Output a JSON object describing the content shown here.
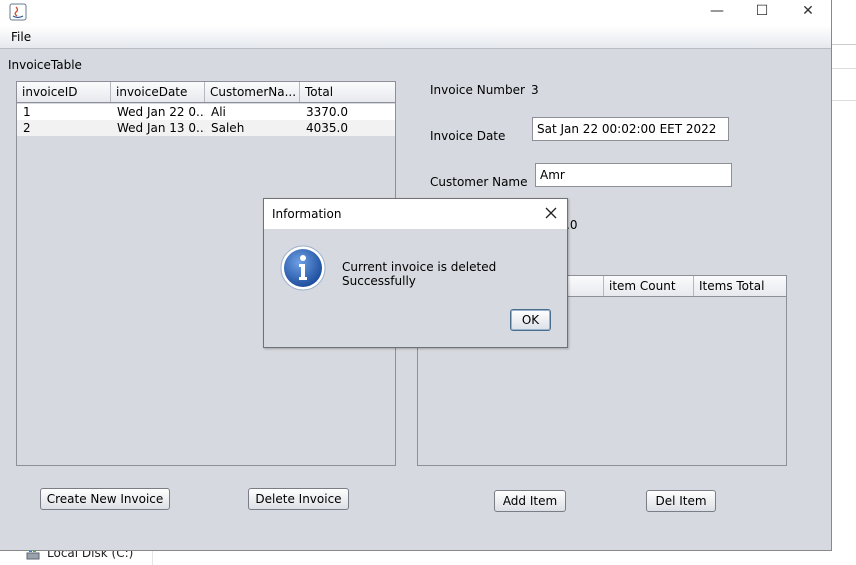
{
  "window": {
    "title": "",
    "minimize_glyph": "—",
    "maximize_glyph": "☐",
    "close_glyph": "✕"
  },
  "menu": {
    "file": "File"
  },
  "invoice_table": {
    "label": "InvoiceTable",
    "columns": [
      "invoiceID",
      "invoiceDate",
      "CustomerNa...",
      "Total"
    ],
    "rows": [
      [
        "1",
        "Wed Jan 22 0...",
        "Ali",
        "3370.0"
      ],
      [
        "2",
        "Wed Jan 13 0...",
        "Saleh",
        "4035.0"
      ]
    ]
  },
  "details": {
    "invoice_number_label": "Invoice Number",
    "invoice_number_value": "3",
    "invoice_date_label": "Invoice Date",
    "invoice_date_value": "Sat Jan 22 00:02:00 EET 2022",
    "customer_name_label": "Customer Name",
    "customer_name_value": "Amr",
    "total_partial": ".0"
  },
  "items_table": {
    "columns": [
      "e",
      "item Count",
      "Items Total"
    ]
  },
  "buttons": {
    "create_invoice": "Create New Invoice",
    "delete_invoice": "Delete Invoice",
    "add_item": "Add Item",
    "del_item": "Del Item"
  },
  "dialog": {
    "title": "Information",
    "message": "Current invoice is deleted Successfully",
    "ok": "OK"
  },
  "background": {
    "drive_label": "Local Disk (C:)"
  },
  "colors": {
    "window_bg": "#d6d9df",
    "info_icon": "#2a63b8",
    "row_alt": "#f2f2f2"
  }
}
